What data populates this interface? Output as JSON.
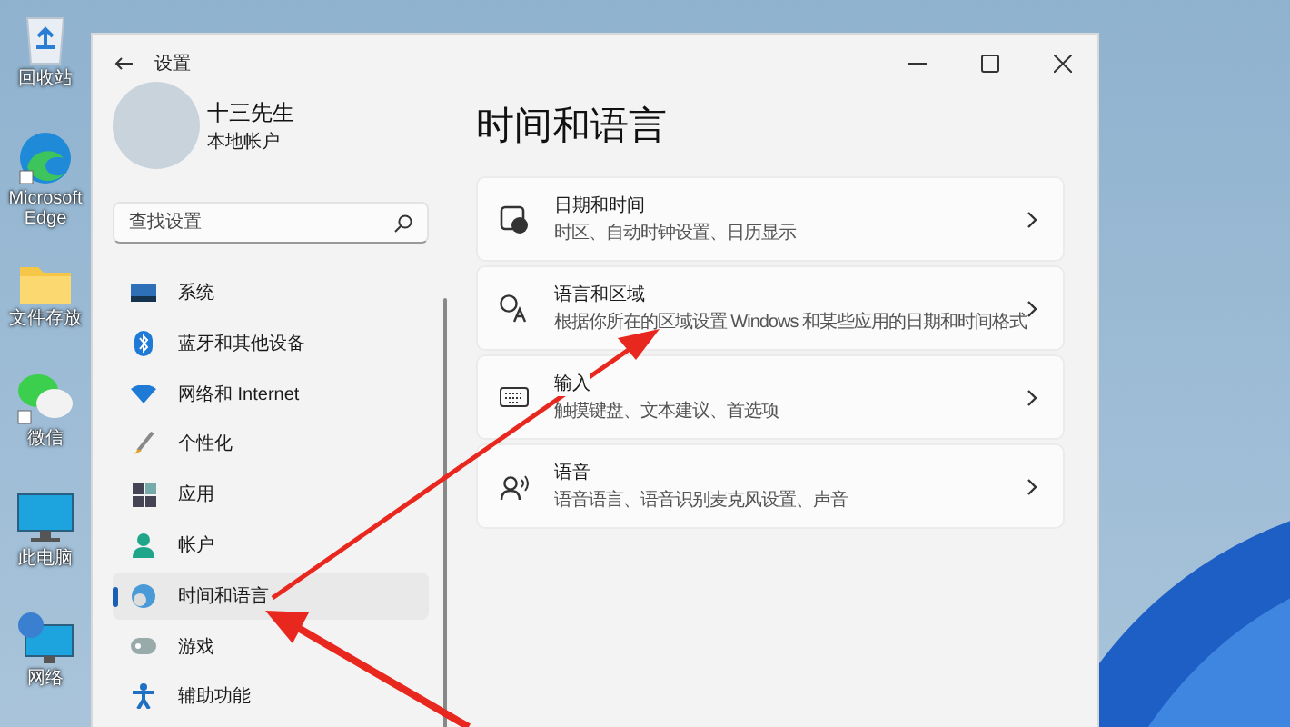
{
  "desktop_icons": [
    {
      "kind": "recycle-bin",
      "label": "回收站"
    },
    {
      "kind": "edge",
      "label": "Microsoft Edge"
    },
    {
      "kind": "folder",
      "label": "文件存放"
    },
    {
      "kind": "chat",
      "label": "微信"
    },
    {
      "kind": "computer",
      "label": "此电脑"
    },
    {
      "kind": "network",
      "label": "网络"
    }
  ],
  "window": {
    "title": "设置"
  },
  "user": {
    "name": "十三先生",
    "account_type": "本地帐户"
  },
  "search": {
    "placeholder": "查找设置"
  },
  "sidebar": {
    "items": [
      {
        "kind": "system",
        "label": "系统",
        "selected": false
      },
      {
        "kind": "bluetooth",
        "label": "蓝牙和其他设备",
        "selected": false
      },
      {
        "kind": "network",
        "label": "网络和 Internet",
        "selected": false
      },
      {
        "kind": "personalization",
        "label": "个性化",
        "selected": false
      },
      {
        "kind": "apps",
        "label": "应用",
        "selected": false
      },
      {
        "kind": "accounts",
        "label": "帐户",
        "selected": false
      },
      {
        "kind": "time-language",
        "label": "时间和语言",
        "selected": true
      },
      {
        "kind": "gaming",
        "label": "游戏",
        "selected": false
      },
      {
        "kind": "accessibility",
        "label": "辅助功能",
        "selected": false
      }
    ]
  },
  "page": {
    "title": "时间和语言",
    "cards": [
      {
        "kind": "clock",
        "title": "日期和时间",
        "description": "时区、自动时钟设置、日历显示"
      },
      {
        "kind": "language",
        "title": "语言和区域",
        "description": "根据你所在的区域设置 Windows 和某些应用的日期和时间格式"
      },
      {
        "kind": "keyboard",
        "title": "输入",
        "description": "触摸键盘、文本建议、首选项"
      },
      {
        "kind": "speech",
        "title": "语音",
        "description": "语音语言、语音识别麦克风设置、声音"
      }
    ]
  }
}
